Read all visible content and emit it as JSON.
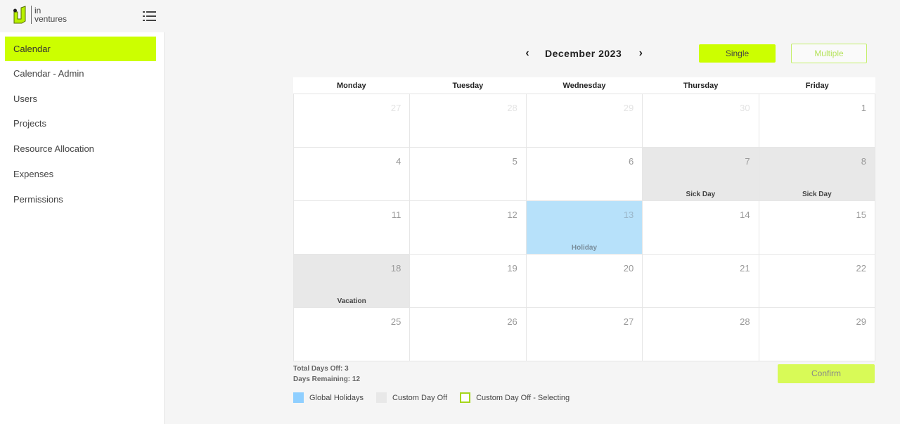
{
  "brand": {
    "line1": "in",
    "line2": "ventures",
    "accent": "#ccff00"
  },
  "sidebar": {
    "items": [
      {
        "label": "Calendar",
        "active": true
      },
      {
        "label": "Calendar - Admin"
      },
      {
        "label": "Users"
      },
      {
        "label": "Projects"
      },
      {
        "label": "Resource Allocation"
      },
      {
        "label": "Expenses"
      },
      {
        "label": "Permissions"
      }
    ]
  },
  "calendar": {
    "month_label": "December 2023",
    "prev_icon": "chevron-left-icon",
    "next_icon": "chevron-right-icon",
    "mode_single": "Single",
    "mode_multiple": "Multiple",
    "selected_mode": "Single",
    "weekdays": [
      "Monday",
      "Tuesday",
      "Wednesday",
      "Thursday",
      "Friday"
    ],
    "weeks": [
      [
        {
          "day": "27",
          "other": true
        },
        {
          "day": "28",
          "other": true
        },
        {
          "day": "29",
          "other": true
        },
        {
          "day": "30",
          "other": true
        },
        {
          "day": "1"
        }
      ],
      [
        {
          "day": "4"
        },
        {
          "day": "5"
        },
        {
          "day": "6"
        },
        {
          "day": "7",
          "type": "custom",
          "label": "Sick Day"
        },
        {
          "day": "8",
          "type": "custom",
          "label": "Sick Day"
        }
      ],
      [
        {
          "day": "11"
        },
        {
          "day": "12"
        },
        {
          "day": "13",
          "type": "holiday",
          "label": "Holiday"
        },
        {
          "day": "14"
        },
        {
          "day": "15"
        }
      ],
      [
        {
          "day": "18",
          "type": "custom",
          "label": "Vacation"
        },
        {
          "day": "19"
        },
        {
          "day": "20"
        },
        {
          "day": "21"
        },
        {
          "day": "22"
        }
      ],
      [
        {
          "day": "25"
        },
        {
          "day": "26"
        },
        {
          "day": "27"
        },
        {
          "day": "28"
        },
        {
          "day": "29"
        }
      ]
    ]
  },
  "summary": {
    "total_days_off": "Total Days Off: 3",
    "days_remaining": "Days Remaining: 12"
  },
  "confirm_label": "Confirm",
  "legend": {
    "global_holidays": "Global Holidays",
    "custom_day_off": "Custom Day Off",
    "custom_selecting": "Custom Day Off - Selecting",
    "colors": {
      "holiday": "#8fcfff",
      "custom": "#e8e8e8",
      "selecting": "#a5d61c"
    }
  }
}
